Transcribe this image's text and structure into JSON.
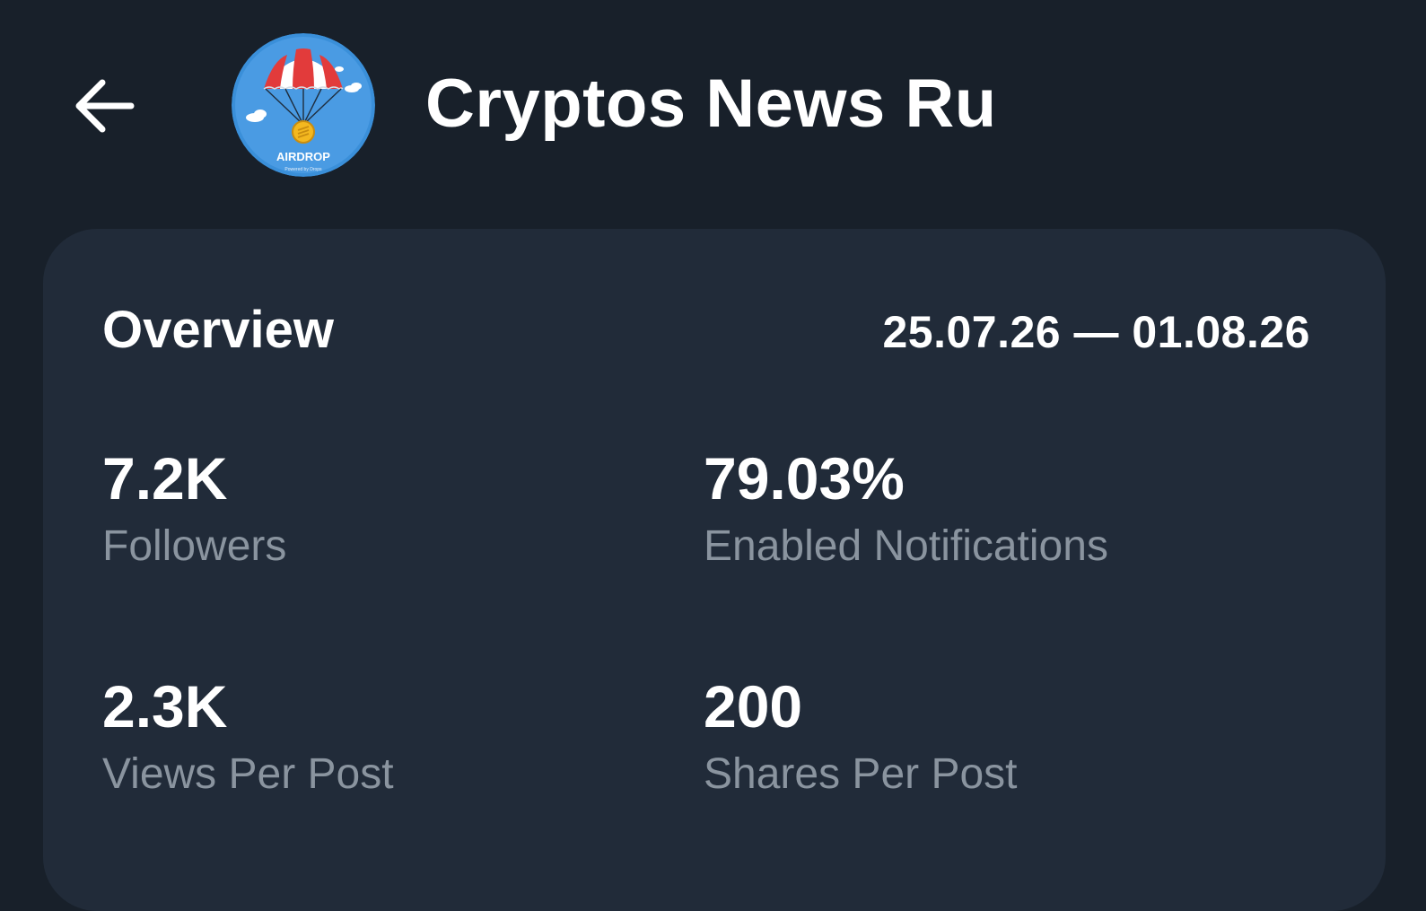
{
  "header": {
    "back_icon": "arrow-left-icon",
    "avatar": {
      "icon": "airdrop-parachute-logo",
      "text": "AIRDROP",
      "subtext": "Powered by Drops",
      "bg_color": "#3a8fd9",
      "canopy_red": "#e23b3b"
    },
    "title": "Cryptos News Ru"
  },
  "overview": {
    "title": "Overview",
    "date_range": "25.07.26 — 01.08.26",
    "stats": [
      {
        "value": "7.2K",
        "label": "Followers"
      },
      {
        "value": "79.03%",
        "label": "Enabled Notifications"
      },
      {
        "value": "2.3K",
        "label": "Views Per Post"
      },
      {
        "value": "200",
        "label": "Shares Per Post"
      }
    ]
  },
  "colors": {
    "background": "#18202a",
    "card": "#212b39",
    "primary_text": "#ffffff",
    "secondary_text": "#8a949f"
  }
}
